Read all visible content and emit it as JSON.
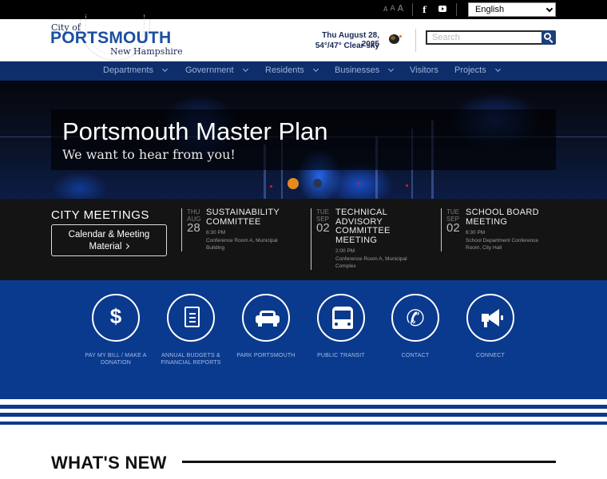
{
  "utility": {
    "font_sizes": [
      "A",
      "A",
      "A"
    ],
    "language": "English",
    "social": [
      "facebook-icon",
      "youtube-icon"
    ]
  },
  "header": {
    "logo_city_of": "City of",
    "logo_main": "PORTSMOUTH",
    "logo_sub": "New Hampshire",
    "weather_date": "Thu August 28, 2025",
    "weather_temp": "54°/47° Clear sky",
    "search_placeholder": "Search"
  },
  "nav": {
    "items": [
      {
        "label": "Departments",
        "dropdown": true
      },
      {
        "label": "Government",
        "dropdown": true
      },
      {
        "label": "Residents",
        "dropdown": true
      },
      {
        "label": "Businesses",
        "dropdown": true
      },
      {
        "label": "Visitors",
        "dropdown": false
      },
      {
        "label": "Projects",
        "dropdown": true
      }
    ]
  },
  "hero": {
    "title": "Portsmouth Master Plan",
    "subtitle": "We want to hear from you!",
    "active_slide": 1,
    "slide_count": 2
  },
  "meetings": {
    "heading": "CITY MEETINGS",
    "button_label": "Calendar & Meeting Material",
    "events": [
      {
        "dow": "THU",
        "month": "AUG",
        "day": "28",
        "title": "SUSTAINABILITY COMMITTEE",
        "time": "6:30 PM",
        "location": "Conference Room A, Municipal Building"
      },
      {
        "dow": "TUE",
        "month": "SEP",
        "day": "02",
        "title": "TECHNICAL ADVISORY COMMITTEE MEETING",
        "time": "2:00 PM",
        "location": "Conference Room A, Municipal Complex"
      },
      {
        "dow": "TUE",
        "month": "SEP",
        "day": "02",
        "title": "SCHOOL BOARD MEETING",
        "time": "6:30 PM",
        "location": "School Department Conference Room, City Hall"
      }
    ]
  },
  "quicklinks": [
    {
      "label": "PAY MY BILL / MAKE A DONATION",
      "icon": "dollar-icon"
    },
    {
      "label": "ANNUAL BUDGETS & FINANCIAL REPORTS",
      "icon": "document-icon"
    },
    {
      "label": "PARK PORTSMOUTH",
      "icon": "car-icon"
    },
    {
      "label": "PUBLIC TRANSIT",
      "icon": "bus-icon"
    },
    {
      "label": "CONTACT",
      "icon": "phone-icon"
    },
    {
      "label": "CONNECT",
      "icon": "megaphone-icon"
    }
  ],
  "whats_new": {
    "heading": "WHAT'S NEW"
  },
  "colors": {
    "navy": "#0d2d6b",
    "quicklink_blue": "#0a3a8e",
    "accent_orange": "#e58a1d",
    "logo_blue": "#1c4ea0"
  }
}
